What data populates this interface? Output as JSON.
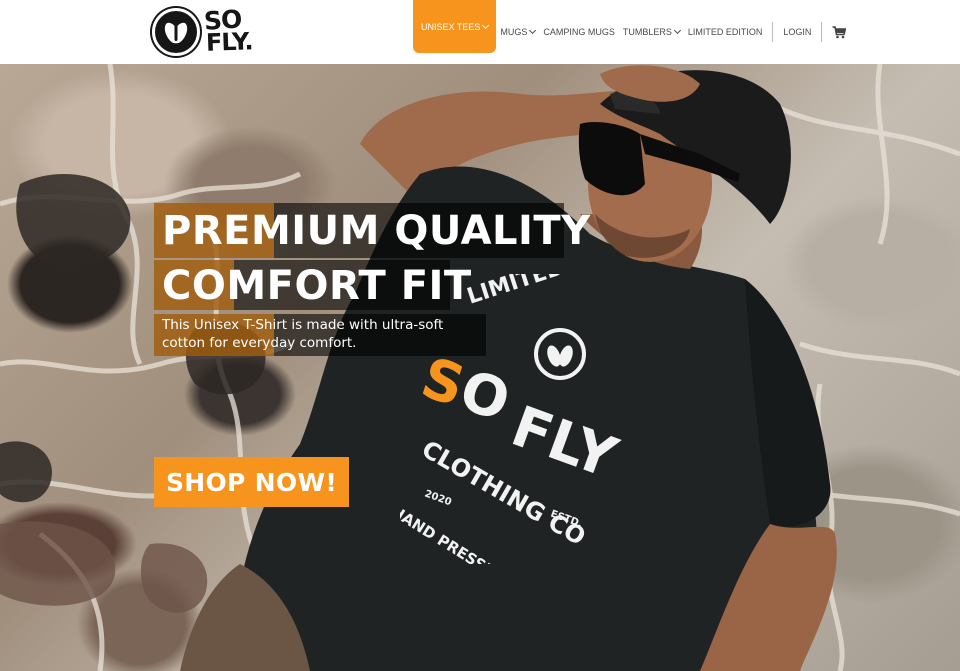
{
  "brand": {
    "logo_text_line1": "SO",
    "logo_text_line2": "FLY."
  },
  "nav": {
    "items": [
      {
        "label": "UNISEX TEES",
        "has_dropdown": true,
        "active": true
      },
      {
        "label": "MUGS",
        "has_dropdown": true
      },
      {
        "label": "CAMPING MUGS",
        "has_dropdown": false
      },
      {
        "label": "TUMBLERS",
        "has_dropdown": true
      },
      {
        "label": "LIMITED EDITION",
        "has_dropdown": false
      }
    ],
    "login": "LOGIN",
    "cart_icon": "cart-icon"
  },
  "hero": {
    "headline_line1": "PREMIUM QUALITY",
    "headline_line2": "COMFORT FIT",
    "subtext_line1": "This Unisex T-Shirt is made with ultra-soft",
    "subtext_line2": "cotton for everyday comfort.",
    "cta": "SHOP NOW!",
    "shirt_print": {
      "arc_text": "LIMITED EDITION",
      "so": "SO",
      "fly": "FLY",
      "clothing_co": "CLOTHING CO",
      "year": "2020",
      "estd": "ESTD.",
      "tagline": "HAND PRESSED APPAREL"
    }
  },
  "colors": {
    "accent": "#f7941d",
    "text": "#4a4a4a",
    "dark": "#161616"
  }
}
